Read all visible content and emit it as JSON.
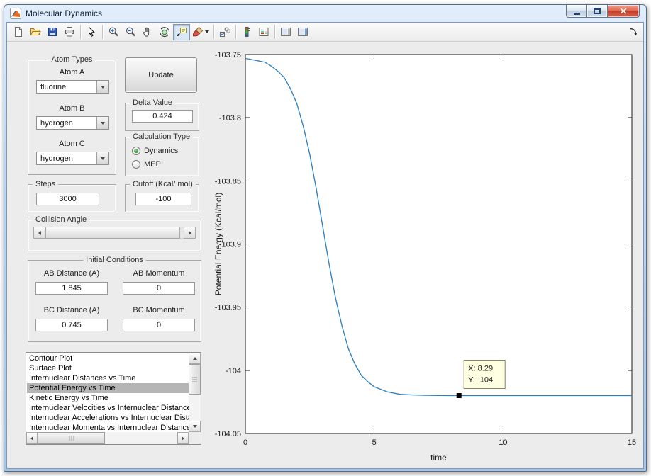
{
  "window": {
    "title": "Molecular Dynamics",
    "controls": [
      "minimize",
      "maximize",
      "close"
    ]
  },
  "toolbar": {
    "groups": [
      [
        {
          "name": "new-figure",
          "icon": "new"
        },
        {
          "name": "open-file",
          "icon": "open"
        },
        {
          "name": "save-figure",
          "icon": "save"
        },
        {
          "name": "print-figure",
          "icon": "print"
        }
      ],
      [
        {
          "name": "edit-plot",
          "icon": "pointer"
        }
      ],
      [
        {
          "name": "zoom-in",
          "icon": "zoom-in"
        },
        {
          "name": "zoom-out",
          "icon": "zoom-out"
        },
        {
          "name": "pan",
          "icon": "hand"
        },
        {
          "name": "rotate-3d",
          "icon": "rotate"
        },
        {
          "name": "data-cursor",
          "icon": "datatip",
          "active": true
        },
        {
          "name": "brush",
          "icon": "brush",
          "caret": true
        }
      ],
      [
        {
          "name": "link-plot",
          "icon": "link"
        }
      ],
      [
        {
          "name": "insert-colorbar",
          "icon": "colorbar"
        },
        {
          "name": "insert-legend",
          "icon": "legend"
        }
      ],
      [
        {
          "name": "hide-plot-tools",
          "icon": "panel-off"
        },
        {
          "name": "show-plot-tools",
          "icon": "panel-on"
        }
      ]
    ],
    "dock": {
      "name": "dock-figure",
      "icon": "dock"
    }
  },
  "panels": {
    "atom_types": {
      "title": "Atom Types",
      "atom_a_label": "Atom A",
      "atom_a_value": "fluorine",
      "atom_b_label": "Atom B",
      "atom_b_value": "hydrogen",
      "atom_c_label": "Atom C",
      "atom_c_value": "hydrogen"
    },
    "update_label": "Update",
    "delta": {
      "title": "Delta Value",
      "value": "0.424"
    },
    "calculation": {
      "title": "Calculation Type",
      "options": [
        {
          "label": "Dynamics",
          "selected": true
        },
        {
          "label": "MEP",
          "selected": false
        }
      ]
    },
    "steps": {
      "title": "Steps",
      "value": "3000"
    },
    "cutoff": {
      "title": "Cutoff (Kcal/ mol)",
      "value": "-100"
    },
    "collision": {
      "title": "Collision Angle"
    },
    "initial": {
      "title": "Initial Conditions",
      "ab_distance_label": "AB Distance (A)",
      "ab_distance_value": "1.845",
      "ab_momentum_label": "AB Momentum",
      "ab_momentum_value": "0",
      "bc_distance_label": "BC Distance (A)",
      "bc_distance_value": "0.745",
      "bc_momentum_label": "BC Momentum",
      "bc_momentum_value": "0"
    },
    "plot_list": {
      "items": [
        "Contour Plot",
        "Surface Plot",
        "Internuclear Distances vs Time",
        "Potential Energy vs Time",
        "Kinetic Energy vs Time",
        "Internuclear Velocities vs Internuclear Distance",
        "Internuclear Accelerations vs Internuclear Distance",
        "Internuclear Momenta vs Internuclear Distance"
      ],
      "selected_index": 3
    }
  },
  "chart_data": {
    "type": "line",
    "title": "",
    "xlabel": "time",
    "ylabel": "Potential Energy (Kcal/mol)",
    "xlim": [
      0,
      15
    ],
    "ylim": [
      -104.05,
      -103.75
    ],
    "xticks": [
      "0",
      "5",
      "10",
      "15"
    ],
    "yticks": [
      "-103.75",
      "-103.8",
      "-103.85",
      "-103.9",
      "-103.95",
      "-104",
      "-104.05"
    ],
    "grid": false,
    "legend": null,
    "line_color": "#2d7dbd",
    "series": [
      {
        "name": "Potential Energy vs Time",
        "x": [
          0,
          0.25,
          0.5,
          0.75,
          1,
          1.25,
          1.5,
          1.75,
          2,
          2.25,
          2.5,
          2.75,
          3,
          3.25,
          3.5,
          3.75,
          4,
          4.25,
          4.5,
          4.75,
          5,
          5.5,
          6,
          6.5,
          7,
          7.5,
          8,
          8.5,
          9,
          10,
          11,
          12,
          13,
          14,
          15
        ],
        "y": [
          -103.753,
          -103.754,
          -103.755,
          -103.756,
          -103.759,
          -103.763,
          -103.768,
          -103.777,
          -103.789,
          -103.807,
          -103.829,
          -103.856,
          -103.886,
          -103.916,
          -103.943,
          -103.965,
          -103.983,
          -103.995,
          -104.004,
          -104.009,
          -104.013,
          -104.017,
          -104.019,
          -104.0195,
          -104.0198,
          -104.0199,
          -104.02,
          -104.02,
          -104.02,
          -104.02,
          -104.02,
          -104.02,
          -104.02,
          -104.02,
          -104.02
        ]
      }
    ],
    "datatip": {
      "x": 8.29,
      "y": -104.02,
      "lines": [
        "X: 8.29",
        "Y: -104"
      ]
    }
  }
}
